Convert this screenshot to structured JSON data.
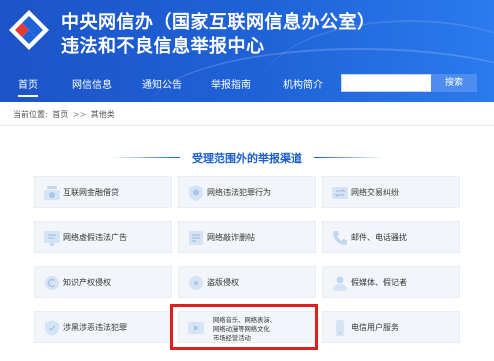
{
  "header": {
    "title_line1": "中央网信办（国家互联网信息办公室）",
    "title_line2": "违法和不良信息举报中心",
    "brand_color": "#1f63d8"
  },
  "nav": {
    "items": [
      "首页",
      "网信信息",
      "通知公告",
      "举报指南",
      "机构简介"
    ],
    "active_index": 0,
    "search_placeholder": "",
    "search_button": "搜索"
  },
  "breadcrumb": {
    "prefix": "当前位置:",
    "home": "首页",
    "separator": ">>",
    "current": "其他类"
  },
  "section": {
    "title": "受理范围外的举报渠道"
  },
  "cards": [
    {
      "label": "互联网金融借贷",
      "icon": "finance-icon"
    },
    {
      "label": "网络违法犯罪行为",
      "icon": "police-icon"
    },
    {
      "label": "网络交易纠纷",
      "icon": "transaction-icon"
    },
    {
      "label": "网络虚假违法广告",
      "icon": "advertisement-icon"
    },
    {
      "label": "网络敲诈删帖",
      "icon": "extortion-icon"
    },
    {
      "label": "邮件、电话骚扰",
      "icon": "phone-icon"
    },
    {
      "label": "知识产权侵权",
      "icon": "copyright-icon"
    },
    {
      "label": "盗版侵权",
      "icon": "piracy-icon"
    },
    {
      "label": "假媒体、假记者",
      "icon": "fake-media-icon"
    },
    {
      "label": "涉黑涉恶违法犯罪",
      "icon": "gang-crime-icon"
    },
    {
      "label_lines": [
        "网络音乐、网络表演、",
        "网络动漫等网络文化",
        "市场经营活动"
      ],
      "icon": "culture-icon",
      "highlighted": true
    },
    {
      "label": "电信用户服务",
      "icon": "telecom-icon"
    }
  ],
  "highlight_color": "#e02020"
}
